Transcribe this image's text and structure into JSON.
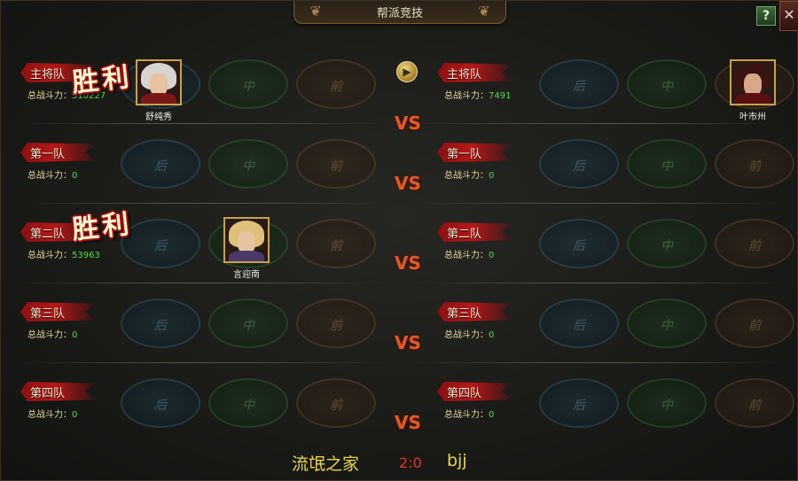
{
  "title": "帮派竞技",
  "help_label": "?",
  "close_label": "✕",
  "power_label": "总战斗力：",
  "vs_label": "VS",
  "win_label": "胜利",
  "slot_glyphs": {
    "back": "后",
    "middle": "中",
    "front": "前"
  },
  "rows": [
    {
      "left": {
        "name": "主将队",
        "power": "510227",
        "win": true,
        "avatar_name": "舒纯秀"
      },
      "right": {
        "name": "主将队",
        "power": "7491",
        "win": false,
        "avatar_name": "叶市州"
      }
    },
    {
      "left": {
        "name": "第一队",
        "power": "0",
        "win": false,
        "avatar_name": ""
      },
      "right": {
        "name": "第一队",
        "power": "0",
        "win": false,
        "avatar_name": ""
      }
    },
    {
      "left": {
        "name": "第二队",
        "power": "53963",
        "win": true,
        "avatar_name": "言迎南"
      },
      "right": {
        "name": "第二队",
        "power": "0",
        "win": false,
        "avatar_name": ""
      }
    },
    {
      "left": {
        "name": "第三队",
        "power": "0",
        "win": false,
        "avatar_name": ""
      },
      "right": {
        "name": "第三队",
        "power": "0",
        "win": false,
        "avatar_name": ""
      }
    },
    {
      "left": {
        "name": "第四队",
        "power": "0",
        "win": false,
        "avatar_name": ""
      },
      "right": {
        "name": "第四队",
        "power": "0",
        "win": false,
        "avatar_name": ""
      }
    }
  ],
  "footer": {
    "guild_left": "流氓之家",
    "score": "2:0",
    "guild_right": "bjj"
  },
  "colors": {
    "accent_vs": "#e05a28",
    "power_value": "#4fdc4a",
    "win_outline": "#a01010",
    "guild_name": "#e8d848"
  }
}
